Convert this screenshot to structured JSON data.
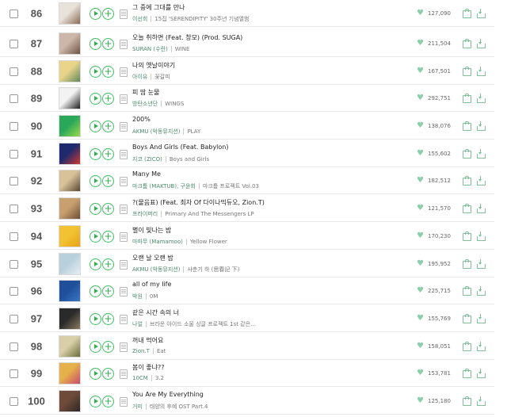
{
  "chart": {
    "rows": [
      {
        "rank": "86",
        "title": "그 중에 그대를 만나",
        "artist": "이선희",
        "album": "15집 'SERENDIPITY' 30주년 기념앨범",
        "likes": "127,090",
        "art": [
          "#e8e2da",
          "#8a6a55"
        ]
      },
      {
        "rank": "87",
        "title": "오늘 취하면 (Feat. 창모) (Prod. SUGA)",
        "artist": "SURAN (수란)",
        "album": "WINE",
        "likes": "211,504",
        "art": [
          "#cbb6a7",
          "#6e5246"
        ]
      },
      {
        "rank": "88",
        "title": "나의 옛날이야기",
        "artist": "아이유",
        "album": "꽃갈피",
        "likes": "167,501",
        "art": [
          "#e9d48a",
          "#5f8a5a"
        ]
      },
      {
        "rank": "89",
        "title": "피 땀 눈물",
        "artist": "방탄소년단",
        "album": "WINGS",
        "likes": "292,751",
        "art": [
          "#f2f2f2",
          "#1e1e1e"
        ]
      },
      {
        "rank": "90",
        "title": "200%",
        "artist": "AKMU (악동뮤지션)",
        "album": "PLAY",
        "likes": "138,076",
        "art": [
          "#2aa85a",
          "#9bd94a"
        ]
      },
      {
        "rank": "91",
        "title": "Boys And Girls (Feat. Babylon)",
        "artist": "지코 (ZICO)",
        "album": "Boys and Girls",
        "likes": "155,602",
        "art": [
          "#1f2a6e",
          "#d2382e"
        ]
      },
      {
        "rank": "92",
        "title": "Many Me",
        "artist": "마크툽 (MAKTUB), 구윤회",
        "album": "마크툽 프로젝트 Vol.03",
        "likes": "182,512",
        "art": [
          "#d8c29a",
          "#5a4632"
        ]
      },
      {
        "rank": "93",
        "title": "?(물음표) (Feat. 최자 Of 다이나믹듀오, Zion.T)",
        "artist": "프라이머리",
        "album": "Primary And The Messengers LP",
        "likes": "121,570",
        "art": [
          "#c8a070",
          "#6e4c32"
        ]
      },
      {
        "rank": "94",
        "title": "별이 빛나는 밤",
        "artist": "마마무 (Mamamoo)",
        "album": "Yellow Flower",
        "likes": "170,230",
        "art": [
          "#f2c232",
          "#e8a21a"
        ]
      },
      {
        "rank": "95",
        "title": "오랜 날 오랜 밤",
        "artist": "AKMU (악동뮤지션)",
        "album": "사춘기 하 (思春記 下)",
        "likes": "195,952",
        "art": [
          "#b8cfdc",
          "#e6eef2"
        ]
      },
      {
        "rank": "96",
        "title": "all of my life",
        "artist": "박원",
        "album": "0M",
        "likes": "225,715",
        "art": [
          "#1f4f9a",
          "#3a76c6"
        ]
      },
      {
        "rank": "97",
        "title": "같은 시간 속의 너",
        "artist": "나얼",
        "album": "브라운 아이드 소울 싱글 프로젝트 1st 같은...",
        "likes": "155,769",
        "art": [
          "#2a2a2a",
          "#8a7a60"
        ]
      },
      {
        "rank": "98",
        "title": "꺼내 먹어요",
        "artist": "Zion.T",
        "album": "Eat",
        "likes": "158,051",
        "art": [
          "#d8cfa8",
          "#6b6b3a"
        ]
      },
      {
        "rank": "99",
        "title": "봄이 좋냐??",
        "artist": "10CM",
        "album": "3.2",
        "likes": "153,781",
        "art": [
          "#e6b04a",
          "#c84a6e"
        ]
      },
      {
        "rank": "100",
        "title": "You Are My Everything",
        "artist": "거미",
        "album": "태양의 후예 OST Part.4",
        "likes": "125,180",
        "art": [
          "#6e4a3a",
          "#2e2622"
        ]
      }
    ]
  }
}
